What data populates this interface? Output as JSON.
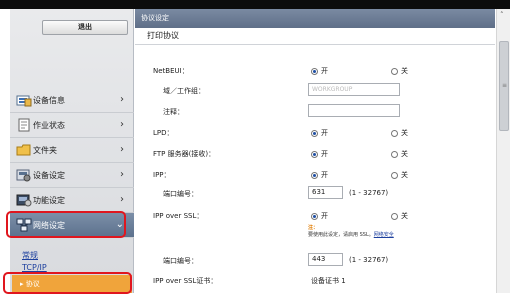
{
  "header": {
    "logout_label": "退出"
  },
  "sidebar": {
    "items": [
      {
        "label": "设备信息",
        "icon": "device-info-icon"
      },
      {
        "label": "作业状态",
        "icon": "job-status-icon"
      },
      {
        "label": "文件夹",
        "icon": "folder-icon"
      },
      {
        "label": "设备设定",
        "icon": "device-settings-icon"
      },
      {
        "label": "功能设定",
        "icon": "function-settings-icon"
      },
      {
        "label": "网络设定",
        "icon": "network-settings-icon"
      }
    ],
    "submenu": [
      {
        "label": "常规"
      },
      {
        "label": "TCP/IP"
      }
    ],
    "active_sub_label": "协议"
  },
  "main": {
    "header_title": "协议设定",
    "section_title": "打印协议",
    "rows": {
      "netbeui": {
        "label": "NetBEUI：",
        "on": "开",
        "off": "关"
      },
      "domain": {
        "label": "域／工作组：",
        "value": "WORKGROUP"
      },
      "comment": {
        "label": "注释：",
        "value": ""
      },
      "lpd": {
        "label": "LPD：",
        "on": "开",
        "off": "关"
      },
      "ftp": {
        "label": "FTP 服务器(接收)：",
        "on": "开",
        "off": "关"
      },
      "ipp": {
        "label": "IPP：",
        "on": "开",
        "off": "关"
      },
      "ipp_port": {
        "label": "端口编号：",
        "value": "631",
        "range": "(1 - 32767)"
      },
      "ipp_ssl": {
        "label": "IPP over SSL：",
        "on": "开",
        "off": "关"
      },
      "ipp_ssl_note": {
        "prefix": "注：",
        "text": "要使用此设定，请启用 SSL。",
        "link": "网络安全"
      },
      "ipp_ssl_port": {
        "label": "端口编号：",
        "value": "443",
        "range": "(1 - 32767)"
      },
      "ipp_ssl_cert": {
        "label": "IPP over SSL证书：",
        "value": "设备证书 1"
      }
    }
  },
  "colors": {
    "highlight": "#e0161e",
    "active_sub": "#f0a43b",
    "header": "#6a7a93"
  }
}
